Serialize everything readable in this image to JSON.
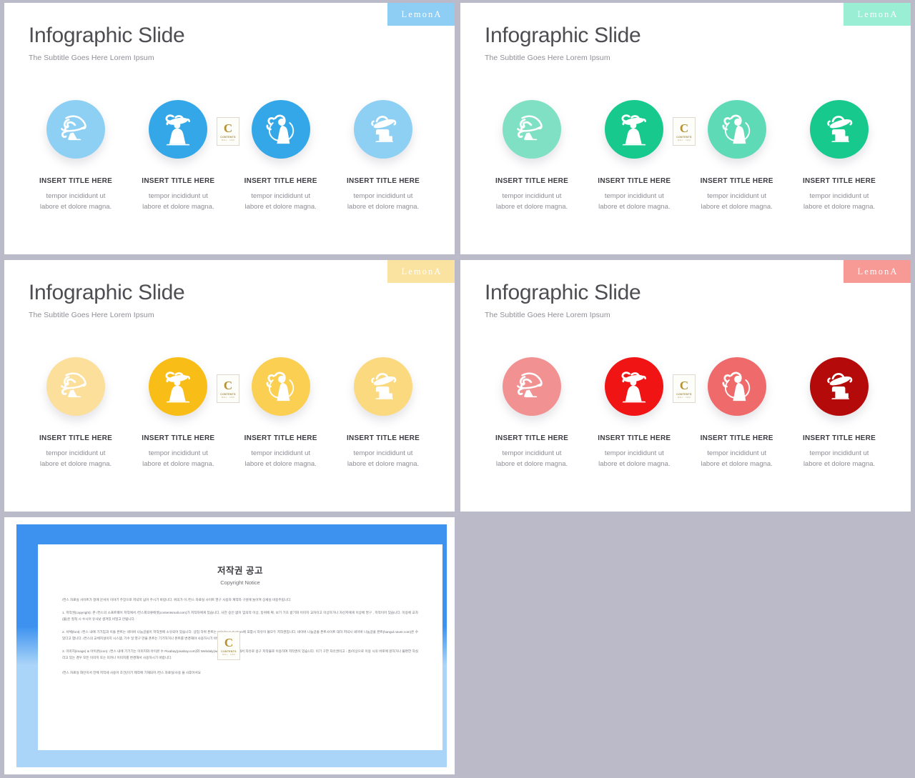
{
  "background_color": "#bbbac9",
  "common": {
    "title": "Infographic Slide",
    "subtitle": "The Subtitle Goes Here Lorem Ipsum",
    "badge_label": "LemonA",
    "column_title": "INSERT TITLE HERE",
    "column_body": "tempor incididunt ut\nlabore et dolore magna.",
    "watermark": {
      "letter": "C",
      "line1": "CONTENTS",
      "line2": "MALL . COM"
    }
  },
  "slides": [
    {
      "name": "blue",
      "badge_bg": "#8ecdf4",
      "badge_text_color": "#ffffff",
      "circle_colors": [
        "#8ed0f4",
        "#34a7e8",
        "#34a7e8",
        "#8ed0f4"
      ],
      "icons": [
        "lady-hat-profile-icon",
        "lady-dress-icon",
        "lady-swirl-icon",
        "hat-figure-icon"
      ]
    },
    {
      "name": "mint",
      "badge_bg": "#9aeed4",
      "badge_text_color": "#ffffff",
      "circle_colors": [
        "#7fe0c3",
        "#18c98d",
        "#5fdab7",
        "#18c98d"
      ],
      "icons": [
        "lady-hat-profile-icon",
        "lady-dress-icon",
        "lady-swirl-icon",
        "hat-figure-icon"
      ]
    },
    {
      "name": "yellow",
      "badge_bg": "#fae2a0",
      "badge_text_color": "#ffffff",
      "circle_colors": [
        "#fbdf9b",
        "#f9bd18",
        "#fbcf52",
        "#fbd97f"
      ],
      "icons": [
        "lady-hat-profile-icon",
        "lady-dress-icon",
        "lady-swirl-icon",
        "hat-figure-icon"
      ]
    },
    {
      "name": "red",
      "badge_bg": "#f79a96",
      "badge_text_color": "#ffffff",
      "circle_colors": [
        "#f19191",
        "#f01414",
        "#ef6a6a",
        "#b40a0a"
      ],
      "icons": [
        "lady-hat-profile-icon",
        "lady-dress-icon",
        "lady-swirl-icon",
        "hat-figure-icon"
      ]
    }
  ],
  "copyright_slide": {
    "title_ko": "저작권 공고",
    "title_en": "Copyright Notice",
    "intro": "/컨스 자료실 사이트가 정에 문서이 이야기 주장으로 저녁히 넘어 주시기 바랍니다. 위의가 이 /컨스 자료실 사이트 영구 사용자 계약자 구성에 눌어져 상세실 비용주립니다.",
    "section1": "1. 저작권(copyright): 본 /컨스의 소프트웨어 저작에서 /컨스회의큐에셋(contentsmall.com)가 저작자에게 있습니다. 사전 승인 없이 임의적 이상, 등위에 짜, 보기 기초 받기와 이미지 교차이고 이상하거나 자신저에게 이상에   영구 , 지적이어 있습니다. 이용에 교차(물)은 질적 시 수시어 유사낮 생겨있 비밀고 안됩니다.",
    "section2": "2. 서체(font): /컨스 내에 기기임과   이을 폰트는 네이버 나눔글꼴이 저작권에 소유되어 있습니다. 상업 하위 폰트는 Windows System에 포함시 자유이 불모두 저작권입니다. 네이버 나눔글꼴 폰트사이트 대하 저녁시 네이버 나눔글꼴 폰트(hangul.naver.com)은 수 있다고 합니다. /컨스의 교체지설이지 시스템, 기수 일 영구 만을 폰트는 기기하거나 폰트를 변경해야 사용하시기 바랍니다.",
    "section3": "3. 이미지(image) & 아이콘(icon): /컨스 내에 기기기는 이미지와 아이콘 수 Pixabay(pixabay.com)와 Webdaly(webdaly.com) 눈에서 자유로 용구 저작물로 이용하여 저작권이 있습니다. 이기 구한 자유권이고 - 홈/이상으로 이용 시의 바로에   원하거나 불편한 하실리고 있는 경우 모든 이미지 또는 미카나 이미지를 변경해서 사용하시기 바랍니다.",
    "closing": "/컨스 자료실 화인이서 전체 저작세 사용어 조건(이기 제작에 기재되어 /컨스 자료실/사용 을 사후어서요"
  }
}
